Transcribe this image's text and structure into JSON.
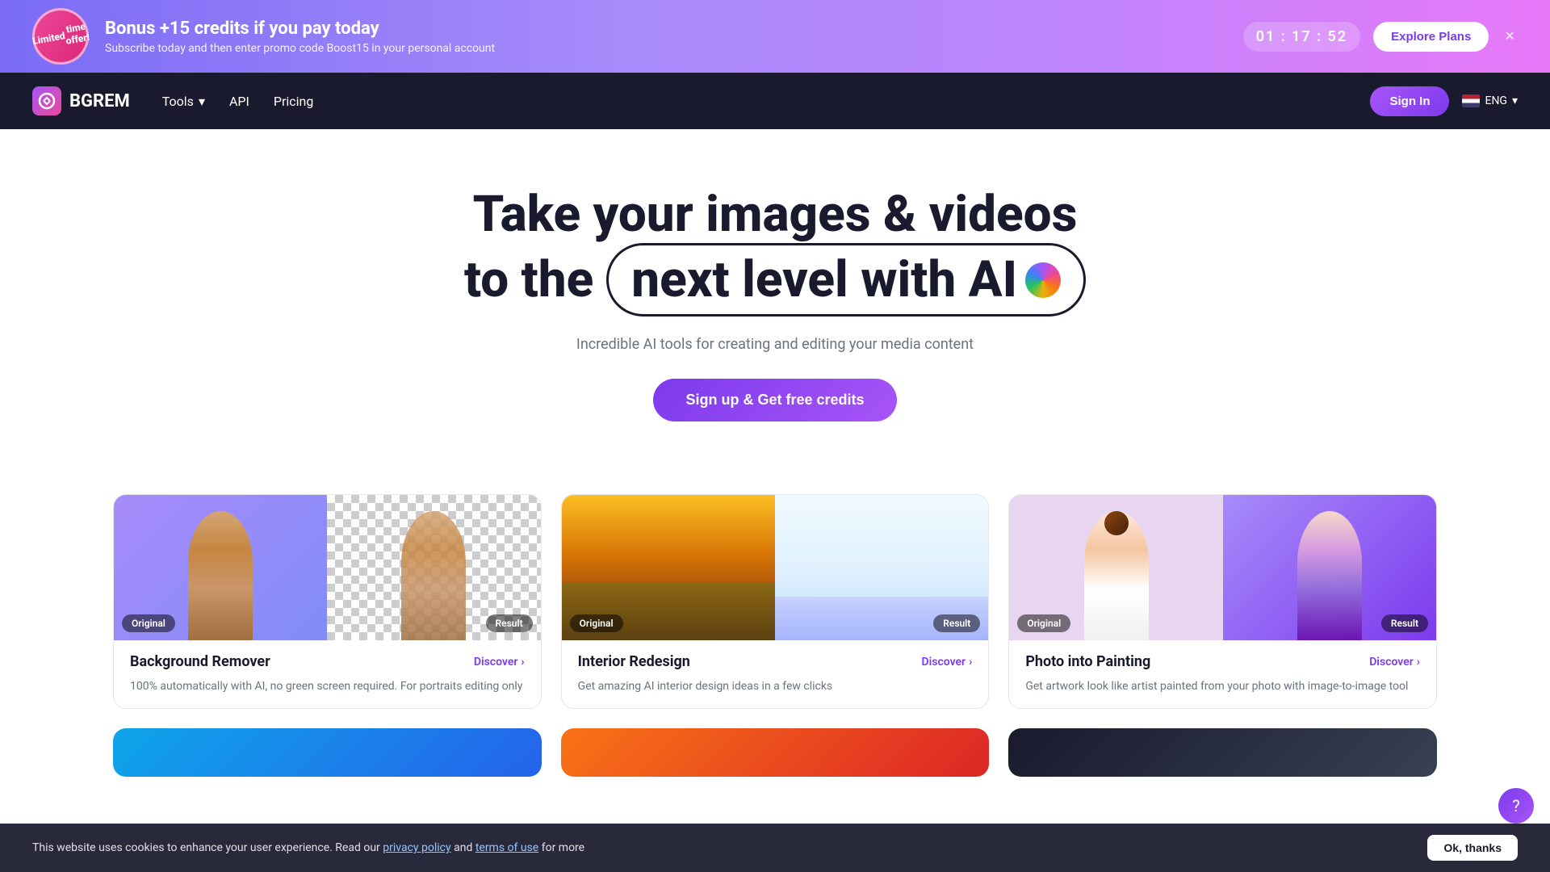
{
  "promo": {
    "badge_line1": "Limited",
    "badge_line2": "time offer!",
    "title": "Bonus +15 credits if you pay today",
    "subtitle": "Subscribe today and then enter promo code Boost15 in your personal account",
    "countdown": "01 : 17 : 52",
    "explore_label": "Explore Plans",
    "close_label": "×"
  },
  "navbar": {
    "logo_text": "BGREM",
    "tools_label": "Tools",
    "api_label": "API",
    "pricing_label": "Pricing",
    "signin_label": "Sign In",
    "lang_label": "ENG"
  },
  "hero": {
    "headline1": "Take your images & videos",
    "headline2_prefix": "to the",
    "headline2_highlight": "next level with AI",
    "subtitle": "Incredible AI tools for creating and editing your media content",
    "cta_label": "Sign up & Get free credits"
  },
  "cards": [
    {
      "id": "bg-remover",
      "title": "Background Remover",
      "discover": "Discover",
      "label_original": "Original",
      "label_result": "Result",
      "description": "100% automatically with AI, no green screen required. For portraits editing only"
    },
    {
      "id": "interior-redesign",
      "title": "Interior Redesign",
      "discover": "Discover",
      "label_original": "Original",
      "label_result": "Result",
      "description": "Get amazing AI interior design ideas in a few clicks"
    },
    {
      "id": "photo-painting",
      "title": "Photo into Painting",
      "discover": "Discover",
      "label_original": "Original",
      "label_result": "Result",
      "description": "Get artwork look like artist painted from your photo with image-to-image tool"
    }
  ],
  "cookie": {
    "text": "This website uses cookies to enhance your user experience. Read our ",
    "privacy_label": "privacy policy",
    "and_text": " and ",
    "terms_label": "terms of use",
    "for_more_text": " for more",
    "ok_label": "Ok, thanks"
  },
  "icons": {
    "chevron_down": "▾",
    "arrow_right": "›",
    "close": "✕",
    "question": "?"
  }
}
